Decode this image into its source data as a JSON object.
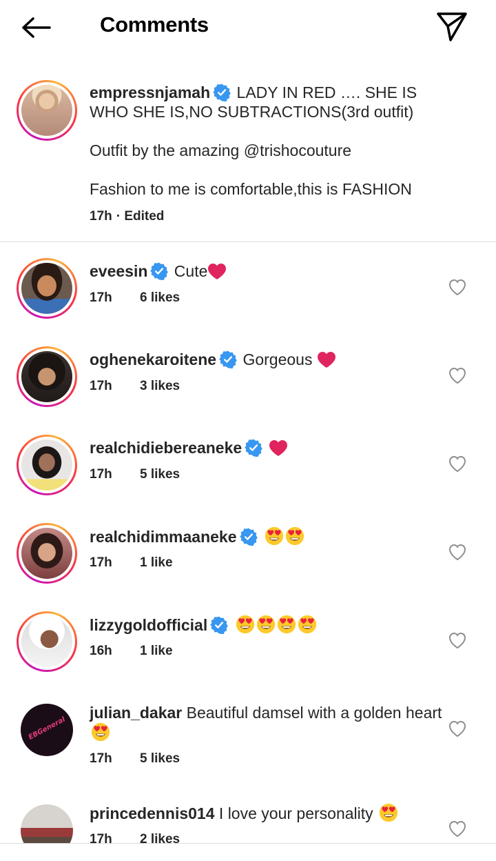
{
  "header": {
    "title": "Comments"
  },
  "caption": {
    "username": "empressnjamah",
    "line1": "LADY IN RED …. SHE IS WHO SHE IS,NO SUBTRACTIONS(3rd outfit)",
    "line2": "Outfit by the amazing @trishocouture",
    "line3": "Fashion to me is comfortable,this is FASHION",
    "time": "17h",
    "edited": "· Edited"
  },
  "comments": [
    {
      "username": "eveesin",
      "text": "Cute",
      "time": "17h",
      "likes": "6 likes"
    },
    {
      "username": "oghenekaroitene",
      "text": "Gorgeous",
      "time": "17h",
      "likes": "3 likes"
    },
    {
      "username": "realchidiebereaneke",
      "text": "",
      "time": "17h",
      "likes": "5 likes"
    },
    {
      "username": "realchidimmaaneke",
      "text": "",
      "time": "17h",
      "likes": "1 like"
    },
    {
      "username": "lizzygoldofficial",
      "text": "",
      "time": "16h",
      "likes": "1 like"
    },
    {
      "username": "julian_dakar",
      "text": "Beautiful damsel with a golden heart",
      "time": "17h",
      "likes": "5 likes"
    },
    {
      "username": "princedennis014",
      "text": "I love your personality",
      "time": "17h",
      "likes": "2 likes"
    }
  ],
  "colors": {
    "verified": "#3897f0",
    "heart_red": "#e0245e",
    "text": "#262626",
    "divider": "#dbdbdb"
  },
  "icons": [
    "back-arrow-icon",
    "send-icon",
    "verified-badge-icon",
    "like-heart-icon",
    "red-heart-emoji",
    "heart-eyes-emoji"
  ]
}
